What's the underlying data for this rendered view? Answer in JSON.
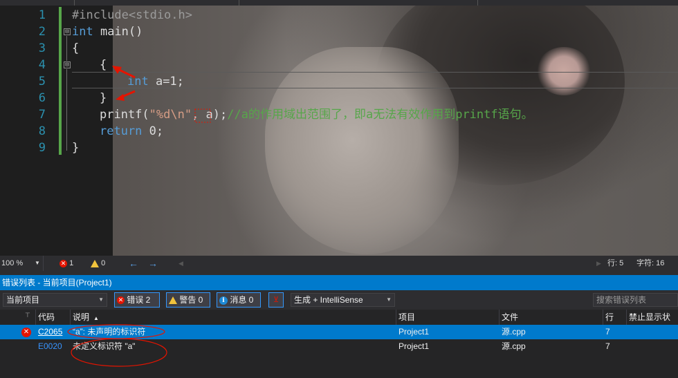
{
  "editor": {
    "line_numbers": [
      "1",
      "2",
      "3",
      "4",
      "5",
      "6",
      "7",
      "8",
      "9"
    ],
    "lines": {
      "l1": {
        "text": "#include<stdio.h>"
      },
      "l2": {
        "kw": "int",
        "rest": " main()"
      },
      "l3": {
        "text": "{"
      },
      "l4": {
        "text": "{"
      },
      "l5": {
        "kw": "int",
        "rest": " a=1;"
      },
      "l6": {
        "text": "}"
      },
      "l7": {
        "fn": "printf(",
        "str": "\"%d\\n\"",
        "rest": ", a);",
        "comment": "//a的作用域出范围了，即a无法有效作用到printf语句。"
      },
      "l8": {
        "kw": "return",
        "rest": " 0;"
      },
      "l9": {
        "text": "}"
      }
    },
    "fold_markers": [
      "⊟",
      "⊟"
    ]
  },
  "status": {
    "zoom": "100 %",
    "errors": "1",
    "warnings": "0",
    "line": "行: 5",
    "col": "字符: 16"
  },
  "errorlist": {
    "title": "错误列表 - 当前项目(Project1)",
    "scope": "当前项目",
    "errors_btn": "错误 2",
    "warnings_btn": "警告 0",
    "messages_btn": "消息 0",
    "build_filter": "生成 + IntelliSense",
    "search_placeholder": "搜索错误列表",
    "columns": {
      "code": "代码",
      "desc": "说明",
      "project": "项目",
      "file": "文件",
      "line": "行",
      "suppress": "禁止显示状态"
    },
    "rows": [
      {
        "code": "C2065",
        "desc": "“a”: 未声明的标识符",
        "project": "Project1",
        "file": "源.cpp",
        "line": "7"
      },
      {
        "code": "E0020",
        "desc": "未定义标识符 \"a\"",
        "project": "Project1",
        "file": "源.cpp",
        "line": "7"
      }
    ]
  },
  "colors": {
    "keyword": "#569cd6",
    "comment": "#57a64a",
    "string": "#d69d85",
    "accent": "#007acc",
    "annotation": "#e51400"
  }
}
